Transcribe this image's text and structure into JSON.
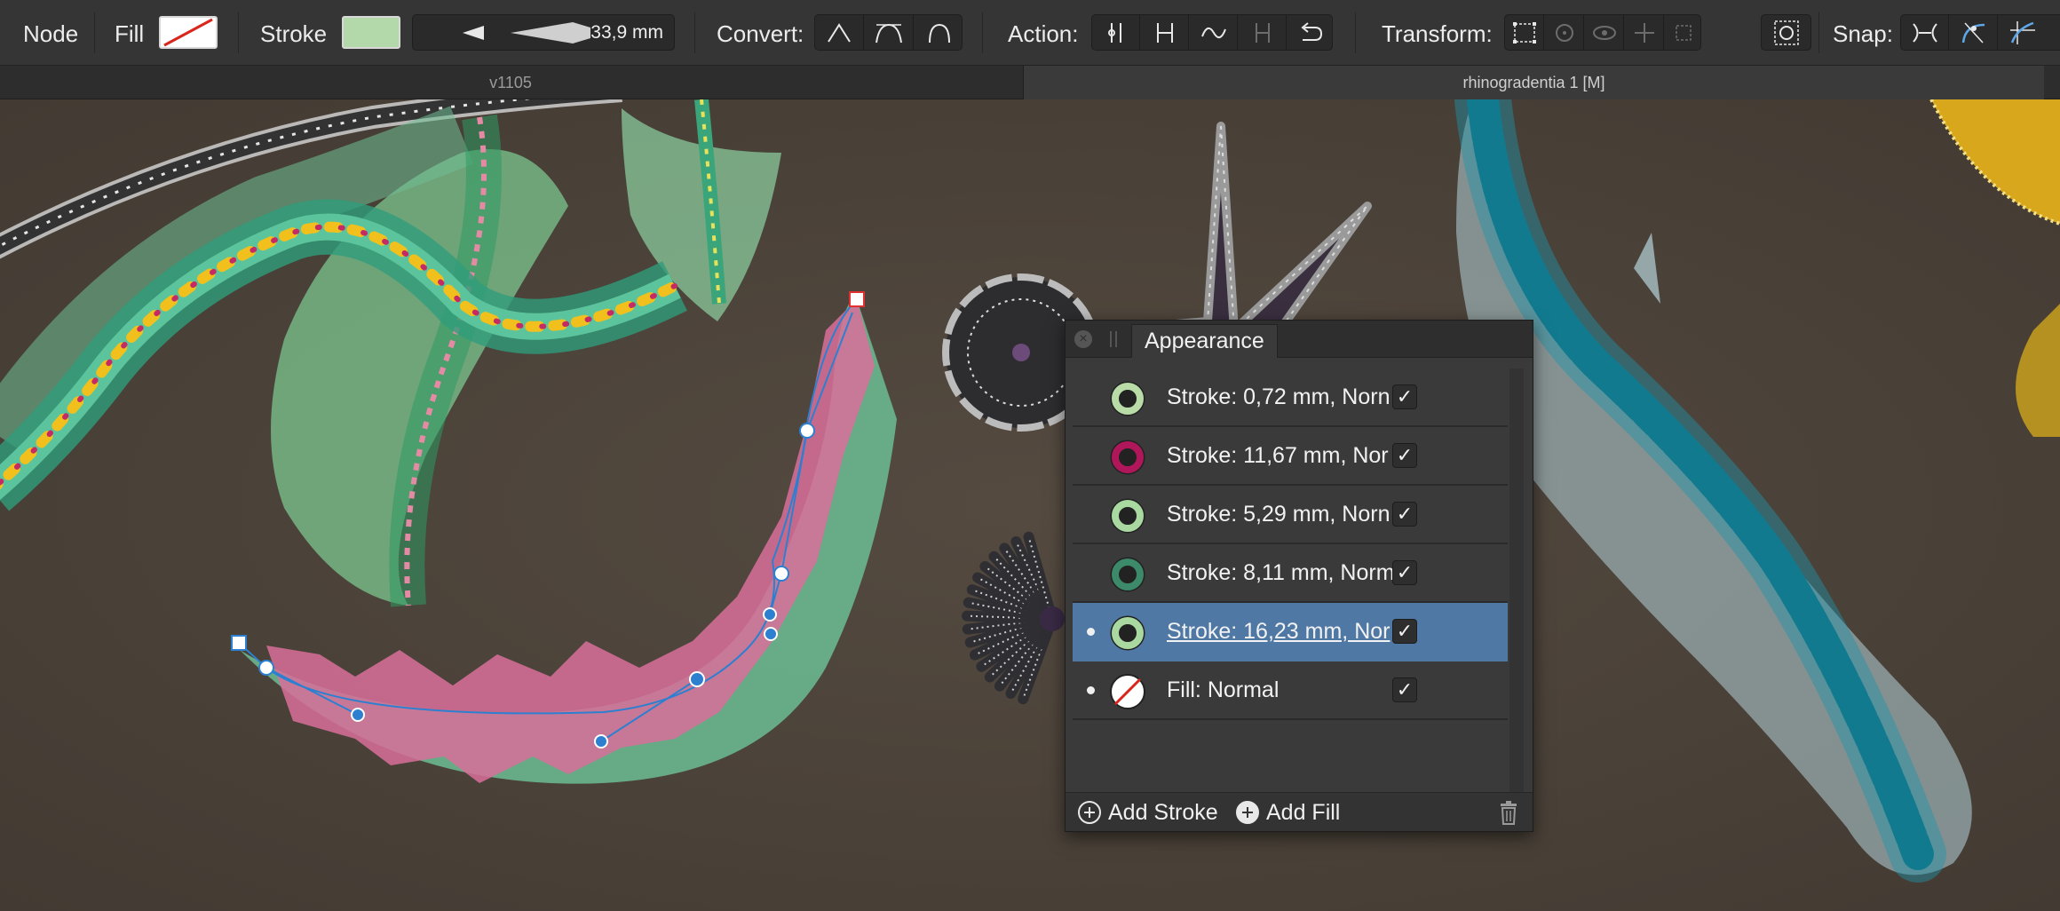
{
  "toolbar": {
    "node_label": "Node",
    "fill_label": "Fill",
    "stroke_label": "Stroke",
    "stroke_width": "33,9 mm",
    "convert_label": "Convert:",
    "action_label": "Action:",
    "transform_label": "Transform:",
    "snap_label": "Snap:",
    "stroke_color": "#b3d9ab",
    "convert_icons": [
      "sharp-node-icon",
      "smooth-node-icon",
      "smart-node-icon"
    ],
    "action_icons": [
      "break-curve-icon",
      "join-curves-icon",
      "smooth-curves-icon",
      "close-curve-icon",
      "reverse-curve-icon"
    ],
    "transform_icons": [
      "transform-box-icon",
      "rotate-icon",
      "show-handles-icon",
      "move-anchor-icon",
      "scale-nodes-icon",
      "transform-mode-icon"
    ],
    "snap_icons": [
      "snap-nodes-icon",
      "snap-curve-icon",
      "snap-grid-icon"
    ]
  },
  "tabs": [
    {
      "label": "v1105",
      "active": false
    },
    {
      "label": "rhinogradentia 1 [M]",
      "active": true
    }
  ],
  "appearance_panel": {
    "title": "Appearance",
    "rows": [
      {
        "label": "Stroke: 0,72 mm, Norn",
        "icon_color": "#b8dba8",
        "checked": "✓",
        "selected": false,
        "bullet": false
      },
      {
        "label": "Stroke: 11,67 mm, Nor",
        "icon_color": "#b0175a",
        "checked": "✓",
        "selected": false,
        "bullet": false
      },
      {
        "label": "Stroke: 5,29 mm, Norn",
        "icon_color": "#a9d9a0",
        "checked": "✓",
        "selected": false,
        "bullet": false
      },
      {
        "label": "Stroke: 8,11 mm, Norm",
        "icon_color": "#3d8a6a",
        "checked": "✓",
        "selected": false,
        "bullet": false
      },
      {
        "label": "Stroke: 16,23 mm, Nor",
        "icon_color": "#a9d9a0",
        "checked": "✓",
        "selected": true,
        "bullet": true
      },
      {
        "label": "Fill: Normal",
        "icon_color": "none",
        "checked": "✓",
        "selected": false,
        "bullet": true
      }
    ],
    "add_stroke_label": "Add Stroke",
    "add_fill_label": "Add Fill"
  },
  "colors": {
    "canvas_bg": "#4a4239",
    "selection_blue": "#4f78a5",
    "node_blue": "#2d7fd0",
    "pink_shape": "#d9709a",
    "green_shape": "#7fc79d"
  }
}
